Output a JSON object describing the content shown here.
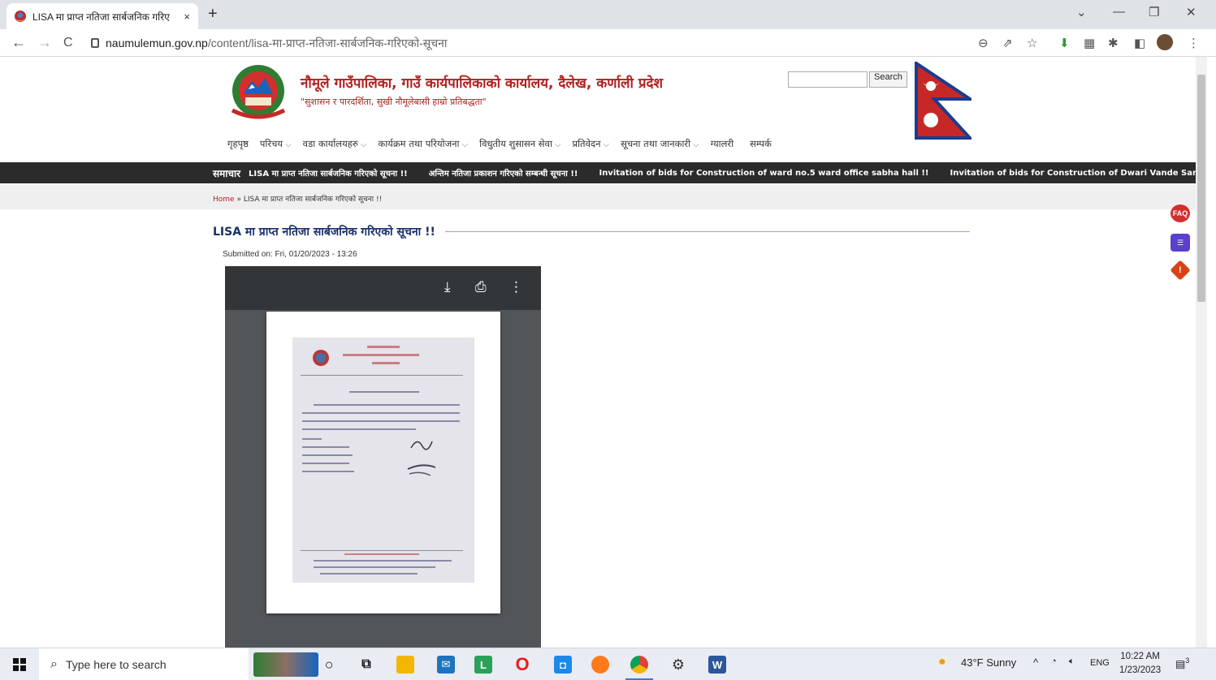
{
  "browser": {
    "tab_title": "LISA मा प्राप्त नतिजा सार्बजनिक गरिए",
    "tab_close": "×",
    "new_tab": "+",
    "url_host": "naumulemun.gov.np",
    "url_path": "/content/lisa-मा-प्राप्त-नतिजा-सार्बजनिक-गरिएको-सूचना",
    "back": "←",
    "forward": "→",
    "reload": "C",
    "win_min": "—",
    "win_max": "❐",
    "win_close": "✕",
    "tab_search": "⌄"
  },
  "site": {
    "title": "नौमूले गाउँपालिका, गाउँ कार्यपालिकाको कार्यालय, दैलेख, कर्णाली प्रदेश",
    "tagline": "\"सुशासन र पारदर्शिता, सुखी नौमूलेबासी हाम्रो प्रतिबद्धता\"",
    "search_button": "Search",
    "nav": [
      {
        "label": "गृहपृष्ठ",
        "dropdown": false
      },
      {
        "label": "परिचय",
        "dropdown": true
      },
      {
        "label": "वडा कार्यालयहरु",
        "dropdown": true
      },
      {
        "label": "कार्यक्रम तथा परियोजना",
        "dropdown": true
      },
      {
        "label": "विधुतीय शुसासन सेवा",
        "dropdown": true
      },
      {
        "label": "प्रतिवेदन",
        "dropdown": true
      },
      {
        "label": "सूचना तथा जानकारी",
        "dropdown": true
      },
      {
        "label": "ग्यालरी",
        "dropdown": false
      },
      {
        "label": "सम्पर्क",
        "dropdown": false
      }
    ],
    "ticker_label": "समाचार",
    "ticker_items": [
      "LISA मा प्राप्त नतिजा सार्बजनिक गरिएको सूचना !!",
      "अन्तिम नतिजा प्रकाशन गरिएको सम्बन्धी सूचना !!",
      "Invitation of bids for Construction of ward no.5 ward office sabha hall !!",
      "Invitation of bids for Construction of Dwari Vande Sanochamlaya Road !!"
    ],
    "breadcrumb_home": "Home",
    "breadcrumb_sep": " » ",
    "breadcrumb_current": "LISA मा प्राप्त नतिजा सार्बजनिक गरिएको सूचना !!",
    "heading": "LISA मा प्राप्त नतिजा सार्बजनिक गरिएको सूचना !!",
    "submitted": "Submitted on: Fri, 01/20/2023 - 13:26",
    "side_faq": "FAQ"
  },
  "pdf_viewer": {
    "download_icon": "download-icon",
    "print_icon": "print-icon",
    "more_icon": "more-icon"
  },
  "taskbar": {
    "search_placeholder": "Type here to search",
    "weather": "43°F  Sunny",
    "lang": "ENG",
    "time": "10:22 AM",
    "date": "1/23/2023",
    "notif_count": "3"
  },
  "colors": {
    "site_red": "#b21f1f",
    "heading_blue": "#1b2f6b",
    "ticker_bg": "#2b2b2b"
  }
}
